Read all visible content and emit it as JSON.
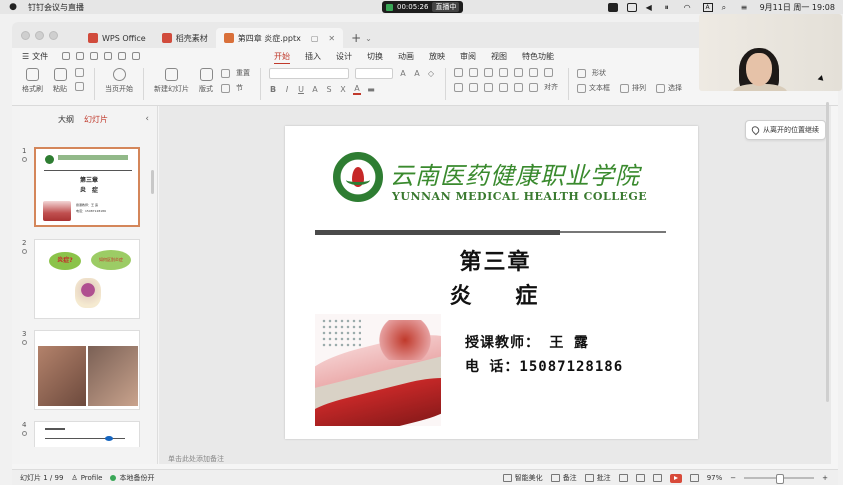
{
  "menubar": {
    "app_name": "钉钉会议与直播",
    "record_time": "00:05:26",
    "live_label": "直播中",
    "datetime": "9月11日 周一 19:08",
    "input_method": "A"
  },
  "tabs": [
    {
      "label": "WPS Office",
      "color": "#d14b3c"
    },
    {
      "label": "稻壳素材",
      "color": "#d14b3c"
    },
    {
      "label": "第四章 炎症.pptx",
      "color": "#d9703a"
    }
  ],
  "menu": {
    "file": "文件",
    "ribbon_tabs": [
      "开始",
      "插入",
      "设计",
      "切换",
      "动画",
      "放映",
      "审阅",
      "视图",
      "特色功能"
    ],
    "active_tab": "开始"
  },
  "ribbon": {
    "format_painter": "格式刷",
    "paste": "粘贴",
    "start_from": "当页开始",
    "new_slide": "新建幻灯片",
    "layout": "版式",
    "reset": "重置",
    "section": "节",
    "align": "对齐",
    "shape": "形状",
    "textbox": "文本框",
    "arrange": "排列",
    "select": "选择"
  },
  "left_panel": {
    "tab_outline": "大纲",
    "tab_slides": "幻灯片",
    "slide_numbers": [
      "1",
      "2",
      "3",
      "4"
    ],
    "thumb1": {
      "chapter": "第三章",
      "title": "炎　症",
      "teacher": "授课教师：王 露",
      "phone": "电话：15087128186"
    },
    "thumb2": {
      "bubble1": "炎症?",
      "bubble2": "如何区别炎症"
    }
  },
  "slide": {
    "school_cn": "云南医药健康职业学院",
    "school_en": "YUNNAN MEDICAL HEALTH COLLEGE",
    "chapter": "第三章",
    "title": "炎  症",
    "teacher": "授课教师： 王  露",
    "phone": "电    话：15087128186"
  },
  "resume_label": "从离开的位置继续",
  "notes_placeholder": "单击此处添加备注",
  "status": {
    "slide_count": "幻灯片 1 / 99",
    "profile": "Profile",
    "backup": "本地备份开",
    "beautify": "智能美化",
    "notes": "备注",
    "comments": "批注",
    "zoom": "97%"
  }
}
